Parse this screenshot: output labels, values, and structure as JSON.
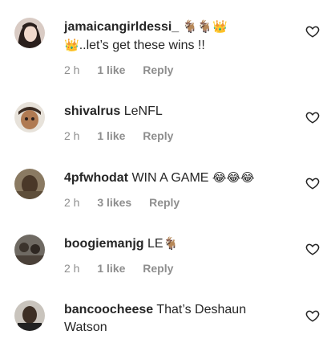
{
  "comments": [
    {
      "username": "jamaicangirldessi_",
      "line1_emoji": "🐐🐐👑",
      "line2_emoji": "👑",
      "text": "..let’s get these wins !!",
      "time": "2 h",
      "likes": "1 like",
      "reply": "Reply"
    },
    {
      "username": "shivalrus",
      "text": "LeNFL",
      "time": "2 h",
      "likes": "1 like",
      "reply": "Reply"
    },
    {
      "username": "4pfwhodat",
      "text": "WIN A GAME",
      "emoji": "😂😂😂",
      "time": "2 h",
      "likes": "3 likes",
      "reply": "Reply"
    },
    {
      "username": "boogiemanjg",
      "text": "LE",
      "emoji": "🐐",
      "time": "2 h",
      "likes": "1 like",
      "reply": "Reply"
    },
    {
      "username": "bancoocheese",
      "text": "That’s Deshaun Watson"
    }
  ],
  "icons": {
    "heart": "heart-outline-icon"
  },
  "colors": {
    "text": "#262626",
    "meta": "#8e8e8e",
    "background": "#ffffff"
  }
}
